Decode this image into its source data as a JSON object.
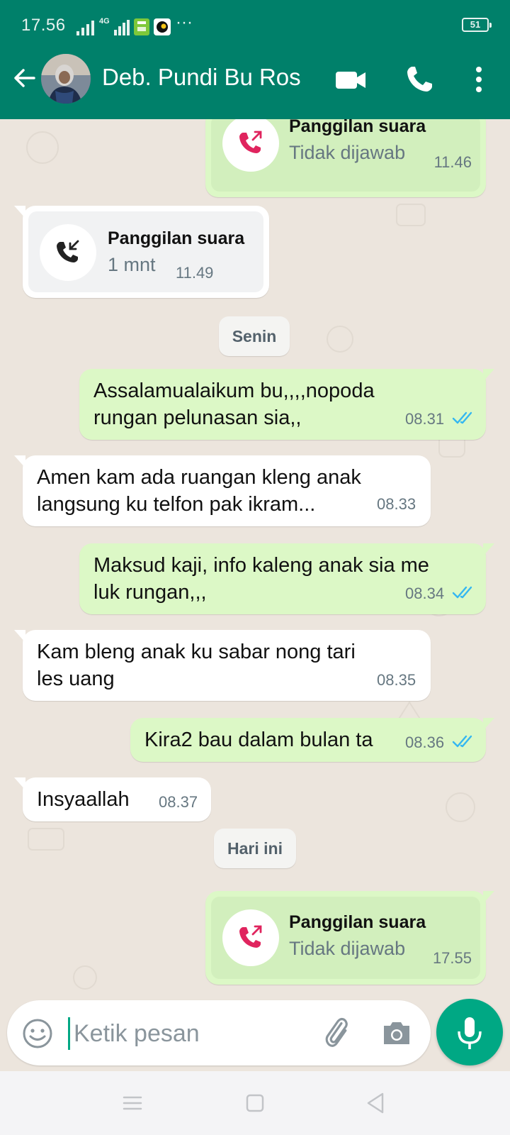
{
  "status_bar": {
    "time": "17.56",
    "network": "4G",
    "more": "···",
    "battery": "51"
  },
  "header": {
    "back_icon": "arrow-left-icon",
    "contact_name": "Deb. Pundi Bu Ros",
    "video_icon": "video-call-icon",
    "call_icon": "phone-icon",
    "menu_icon": "more-vertical-icon"
  },
  "colors": {
    "header": "#00806a",
    "outgoing_bubble": "#dcf8c6",
    "incoming_bubble": "#ffffff",
    "chat_bg": "#ece5dd",
    "accent": "#00a884",
    "read_ticks": "#34b7f1",
    "missed_call": "#e0245e"
  },
  "messages": [
    {
      "kind": "call",
      "dir": "out",
      "title": "Panggilan suara",
      "sub": "Tidak dijawab",
      "time": "11.46"
    },
    {
      "kind": "call",
      "dir": "in",
      "title": "Panggilan suara",
      "sub": "1 mnt",
      "time": "11.49"
    },
    {
      "kind": "date",
      "label": "Senin"
    },
    {
      "kind": "text",
      "dir": "out",
      "lines": [
        "Assalamualaikum bu,,,,nopoda",
        "rungan pelunasan sia,,"
      ],
      "time": "08.31",
      "read": true
    },
    {
      "kind": "text",
      "dir": "in",
      "lines": [
        "Amen kam ada ruangan kleng anak",
        "langsung ku telfon pak ikram..."
      ],
      "time": "08.33"
    },
    {
      "kind": "text",
      "dir": "out",
      "lines": [
        "Maksud kaji, info kaleng anak sia me",
        "luk rungan,,,"
      ],
      "time": "08.34",
      "read": true
    },
    {
      "kind": "text",
      "dir": "in",
      "lines": [
        "Kam bleng anak ku sabar nong tari",
        "les uang"
      ],
      "time": "08.35"
    },
    {
      "kind": "text",
      "dir": "out",
      "lines": [
        "Kira2 bau dalam bulan ta"
      ],
      "time": "08.36",
      "read": true
    },
    {
      "kind": "text",
      "dir": "in",
      "lines": [
        "Insyaallah"
      ],
      "time": "08.37"
    },
    {
      "kind": "date",
      "label": "Hari ini"
    },
    {
      "kind": "call",
      "dir": "out",
      "title": "Panggilan suara",
      "sub": "Tidak dijawab",
      "time": "17.55"
    }
  ],
  "composer": {
    "placeholder": "Ketik pesan",
    "emoji_icon": "emoji-icon",
    "attach_icon": "paperclip-icon",
    "camera_icon": "camera-icon",
    "mic_icon": "microphone-icon"
  },
  "nav": {
    "menu_icon": "recent-apps-icon",
    "home_icon": "home-icon",
    "back_icon": "back-triangle-icon"
  }
}
